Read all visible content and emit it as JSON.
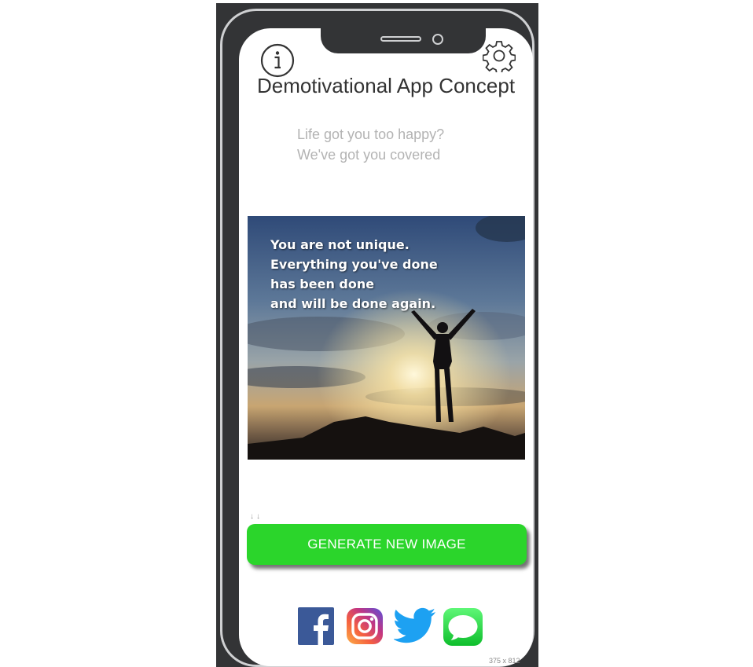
{
  "header": {
    "title": "Demotivational App Concept",
    "info_icon": "info-icon",
    "settings_icon": "gear-icon"
  },
  "tagline": {
    "line1": "Life got you too happy?",
    "line2": "We've got you covered"
  },
  "image": {
    "quote_lines": [
      "You are not unique.",
      "Everything you've done",
      "has been done",
      "and will be done again."
    ]
  },
  "actions": {
    "generate_label": "GENERATE NEW IMAGE",
    "button_color": "#2bd52b"
  },
  "share": {
    "icons": [
      "facebook-icon",
      "instagram-icon",
      "twitter-icon",
      "messages-icon"
    ]
  },
  "canvas_size_label": "375 x 812",
  "colors": {
    "device_frame": "#333436",
    "facebook": "#3b5998",
    "twitter": "#1da1f2",
    "messages": "#34c84a"
  }
}
